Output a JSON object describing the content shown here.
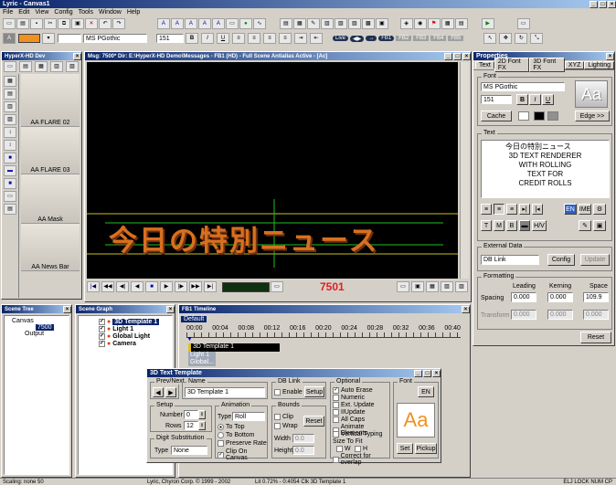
{
  "app": {
    "title": "Lyric - Canvas1"
  },
  "menu": [
    "File",
    "Edit",
    "View",
    "Config",
    "Tools",
    "Window",
    "Help"
  ],
  "toolbar": {
    "font": "MS PGothic",
    "size": "151",
    "bold": "B",
    "italic": "I",
    "underline": "U",
    "live": "Live",
    "fb": "FB1",
    "fb2": "FB2",
    "fb3": "FB3",
    "fb4": "FB4",
    "fb5": "FB5"
  },
  "left_panel": {
    "title": "HyperX-HD Dev",
    "items": [
      "AA FLARE 02",
      "AA FLARE 03",
      "AA Mask",
      "AA News Bar"
    ]
  },
  "viewer": {
    "title": "Msg: 7500* Dir: E:\\HyperX-HD Demo\\Messages - FB1 (HD) - Full Scene Antialias Active - [Ac]",
    "frame": "7501",
    "headline": "今日の特別ニュース"
  },
  "properties": {
    "title": "Properties",
    "tabs": [
      "Text",
      "2D Font FX",
      "3D Font FX",
      "XYZ",
      "Lighting"
    ],
    "font_label": "Font",
    "font": "MS PGothic",
    "size": "151",
    "bold": "B",
    "italic": "I",
    "underline": "U",
    "cache": "Cache",
    "edge": "Edge >>",
    "text_label": "Text",
    "text_lines": [
      "今日の特別ニュース",
      "3D TEXT RENDERER",
      "WITH ROLLING",
      "TEXT FOR",
      "CREDIT ROLLS"
    ],
    "en": "EN",
    "ime": "IME",
    "t_btn": "T",
    "m_btn": "M",
    "b_btn": "B",
    "hv_btn": "H/V",
    "external_label": "External Data",
    "db": "DB Link",
    "config": "Config",
    "update": "Update",
    "formatting_label": "Formatting",
    "leading": "Leading",
    "kerning": "Kerning",
    "space": "Space",
    "spacing": "Spacing",
    "spacing_leading": "0.000",
    "spacing_kerning": "0.000",
    "spacing_space": "109.9",
    "transform": "Transform",
    "transform_leading": "0.000",
    "transform_kerning": "0.000",
    "transform_space": "0.000",
    "reset": "Reset"
  },
  "scene_tree": {
    "title": "Scene Tree",
    "items": [
      "Canvas",
      "7500",
      "Output"
    ]
  },
  "scene_graph": {
    "title": "Scene Graph",
    "items": [
      "3D Template 1",
      "Light 1",
      "Global Light",
      "Camera"
    ]
  },
  "timeline": {
    "title": "FB1 Timeline",
    "default": "Default",
    "ticks": [
      "00:00",
      "00:04",
      "00:08",
      "00:12",
      "00:16",
      "00:20",
      "00:24",
      "00:28",
      "00:32",
      "00:36",
      "00:40"
    ],
    "tracks": [
      "3D Template 1",
      "Light 1",
      "Global..."
    ]
  },
  "dialog": {
    "title": "3D Text Template",
    "prev_next": "Prev/Next",
    "name_label": "Name",
    "name": "3D Template 1",
    "db_link": "DB Link",
    "enable": "Enable",
    "setup": "Setup",
    "optional": "Optional",
    "auto_erase": "Auto Erase",
    "numeric": "Numeric",
    "ext_update": "Ext. Update",
    "iiupdate": "IIUpdate",
    "all_caps": "All Caps",
    "animate_elements": "Animate Elements",
    "vertical_typing": "Vertical Typing",
    "size_to_fit": "Size To Fit",
    "w": "W",
    "h": "H",
    "correct_overlap": "Correct for overlap",
    "font_label": "Font",
    "en": "EN",
    "aa": "Aa",
    "set": "Set",
    "pickup": "Pickup",
    "setup_group": "Setup",
    "number_label": "Number",
    "number": "0",
    "rows_label": "Rows",
    "rows": "12",
    "animation": "Animation",
    "type_label": "Type",
    "anim_type": "Roll",
    "to_top": "To Top",
    "to_bottom": "To Bottom",
    "preserve_rate": "Preserve Rate",
    "clip_on_canvas": "Clip On Canvas",
    "bounds": "Bounds",
    "clip": "Clip",
    "wrap": "Wrap",
    "reset": "Reset",
    "width_label": "Width",
    "width": "0.0",
    "height_label": "Height",
    "height": "0.0",
    "digit_sub": "Digit Substitution",
    "digit_type_label": "Type",
    "digit_type": "None"
  },
  "statusbar": {
    "left": "Scaling: none 50",
    "mid": "Lyric, Chyron Corp. © 1999 - 2002",
    "info": "Lit 0.72% - 0:4054 Clk 3D Template 1",
    "right": "ELJ  LOCK  NUM  CP"
  },
  "colors": {
    "accent": "#0a246a",
    "headline": "#d87020",
    "frame": "#e02020"
  }
}
